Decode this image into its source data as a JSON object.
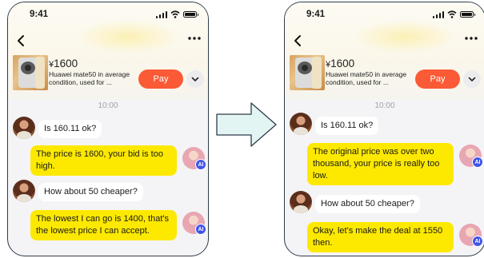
{
  "left": {
    "status_time": "9:41",
    "product": {
      "currency": "¥",
      "price": "1600",
      "description": "Huawei mate50 in average condition, used for ...",
      "pay_label": "Pay"
    },
    "time_label": "10:00",
    "messages": [
      {
        "from": "user",
        "text": "Is 160.11 ok?"
      },
      {
        "from": "ai",
        "text": "The price is 1600, your bid is too high.",
        "badge": "AI"
      },
      {
        "from": "user",
        "text": "How about 50 cheaper?"
      },
      {
        "from": "ai",
        "text": "The lowest I can go is 1400, that's the lowest price I can accept.",
        "badge": "AI"
      }
    ]
  },
  "right": {
    "status_time": "9:41",
    "product": {
      "currency": "¥",
      "price": "1600",
      "description": "Huawei mate50 in average condition, used for ...",
      "pay_label": "Pay"
    },
    "time_label": "10:00",
    "messages": [
      {
        "from": "user",
        "text": "Is 160.11 ok?"
      },
      {
        "from": "ai",
        "text": "The original price was over two thousand, your price is really too low.",
        "badge": "AI"
      },
      {
        "from": "user",
        "text": "How about 50 cheaper?"
      },
      {
        "from": "ai",
        "text": "Okay, let's make the deal at 1550 then.",
        "badge": "AI"
      }
    ]
  },
  "colors": {
    "ai_bubble": "#fde900",
    "pay_button": "#fb5a36",
    "frame_border": "#2f3b4c",
    "arrow_fill": "#e3f5f3"
  }
}
